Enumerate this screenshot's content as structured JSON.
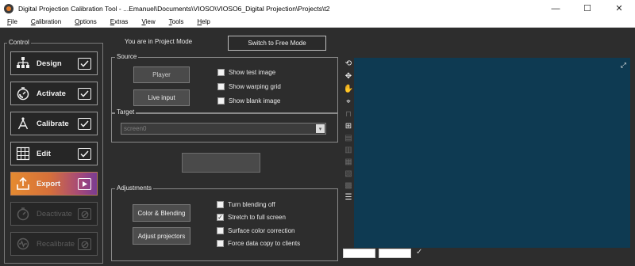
{
  "window": {
    "title": "Digital Projection Calibration Tool - ...Emanuel\\Documents\\VIOSO\\VIOSO6_Digital Projection\\Projects\\t2",
    "controls": [
      "—",
      "☐",
      "✕"
    ]
  },
  "menu": [
    "File",
    "Calibration",
    "Options",
    "Extras",
    "View",
    "Tools",
    "Help"
  ],
  "control": {
    "group_label": "Control",
    "buttons": [
      {
        "label": "Design",
        "icon": "design-tree-icon",
        "state": "checked"
      },
      {
        "label": "Activate",
        "icon": "activate-timer-icon",
        "state": "checked"
      },
      {
        "label": "Calibrate",
        "icon": "calibrate-compass-icon",
        "state": "checked"
      },
      {
        "label": "Edit",
        "icon": "edit-grid-icon",
        "state": "checked"
      },
      {
        "label": "Export",
        "icon": "export-tray-icon",
        "state": "play"
      },
      {
        "label": "Deactivate",
        "icon": "deactivate-icon",
        "state": "disabled"
      },
      {
        "label": "Recalibrate",
        "icon": "recalibrate-icon",
        "state": "disabled"
      }
    ]
  },
  "mode": {
    "text": "You are in Project Mode",
    "switch_label": "Switch to Free Mode"
  },
  "source": {
    "group_label": "Source",
    "player_label": "Player",
    "live_input_label": "Live input",
    "options": [
      {
        "label": "Show test image",
        "checked": false
      },
      {
        "label": "Show warping grid",
        "checked": false
      },
      {
        "label": "Show blank image",
        "checked": false
      }
    ]
  },
  "target": {
    "group_label": "Target",
    "selected": "screen0"
  },
  "adjustments": {
    "group_label": "Adjustments",
    "color_blending_label": "Color & Blending",
    "adjust_projectors_label": "Adjust projectors",
    "options": [
      {
        "label": "Turn blending off",
        "checked": false
      },
      {
        "label": "Stretch to full screen",
        "checked": true
      },
      {
        "label": "Surface color correction",
        "checked": false
      },
      {
        "label": "Force data copy to clients",
        "checked": false
      }
    ]
  },
  "viewport": {
    "background": "#0e3a52",
    "tools": [
      "rotate-icon",
      "move-icon",
      "hand-icon",
      "pin-icon",
      "dim-tool-icon",
      "grid-icon",
      "dim-tool-icon",
      "dim-tool-icon",
      "dim-tool-icon",
      "dim-tool-icon",
      "dim-tool-icon",
      "list-icon"
    ],
    "fields": [
      "",
      ""
    ]
  }
}
